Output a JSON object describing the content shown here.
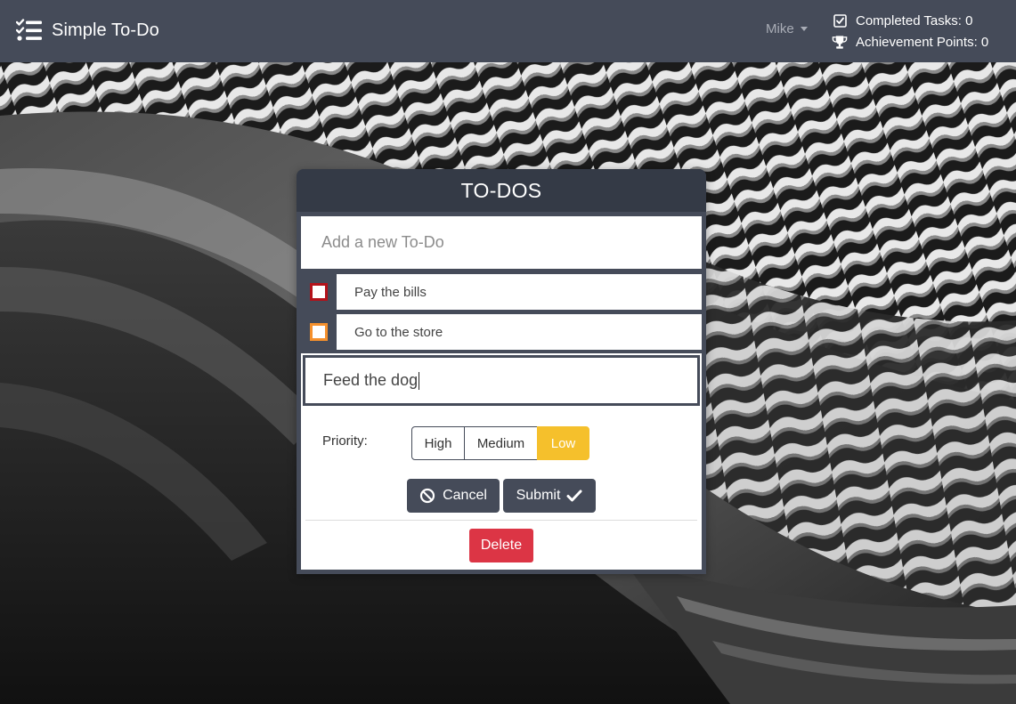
{
  "navbar": {
    "brand_icon": "checklist-icon",
    "brand_text": "Simple To-Do",
    "user_name": "Mike",
    "completed_tasks_label": "Completed Tasks: 0",
    "achievement_points_label": "Achievement Points: 0",
    "completed_icon": "checked-box-icon",
    "achievement_icon": "trophy-icon",
    "background_color": "#454b59"
  },
  "panel": {
    "title": "TO-DOS",
    "new_todo_placeholder": "Add a new To-Do",
    "todos": [
      {
        "text": "Pay the bills",
        "priority": "high",
        "color": "#b3121a"
      },
      {
        "text": "Go to the store",
        "priority": "medium",
        "color": "#f5902c"
      }
    ],
    "editing": {
      "value": "Feed the dog",
      "priority_label": "Priority:",
      "priority_options": [
        "High",
        "Medium",
        "Low"
      ],
      "selected_priority": "Low",
      "cancel_label": "Cancel",
      "submit_label": "Submit",
      "delete_label": "Delete",
      "cancel_icon": "ban-icon",
      "submit_icon": "checkmark-icon"
    }
  },
  "colors": {
    "accent": "#454b59",
    "header_dark": "#343a46",
    "low_priority": "#f5c02c",
    "danger": "#dc3545"
  }
}
